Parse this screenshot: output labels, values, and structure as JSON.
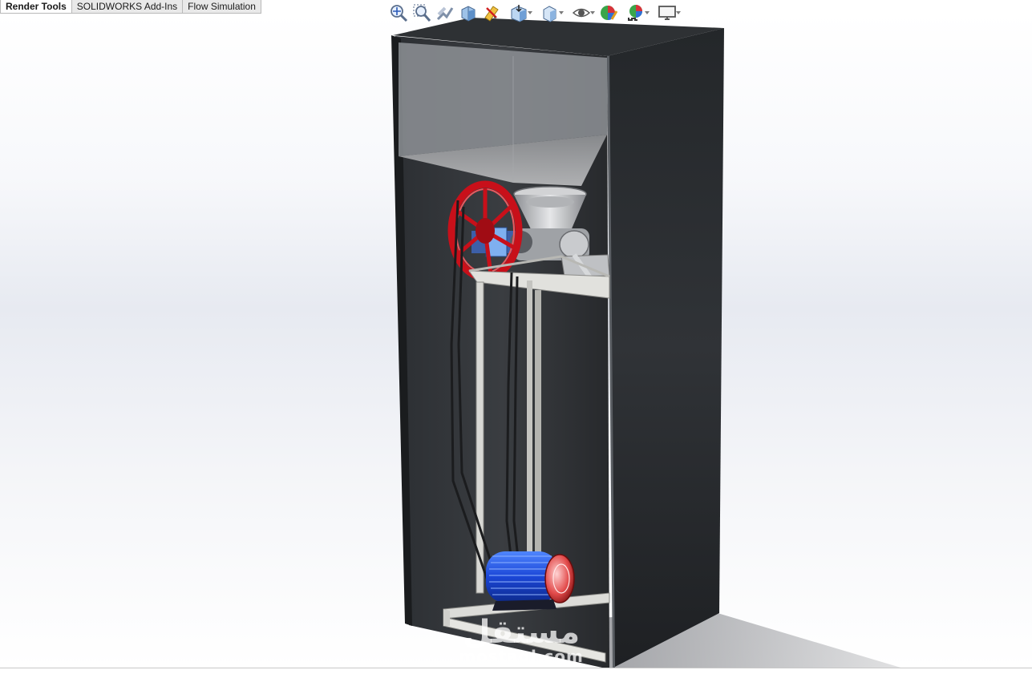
{
  "tabs": [
    {
      "label": "Render Tools",
      "active": true
    },
    {
      "label": "SOLIDWORKS Add-Ins",
      "active": false
    },
    {
      "label": "Flow Simulation",
      "active": false
    }
  ],
  "hud_toolbar": [
    {
      "icon": "zoom-to-fit-icon",
      "dropdown": false
    },
    {
      "icon": "zoom-to-area-icon",
      "dropdown": false
    },
    {
      "icon": "previous-view-icon",
      "dropdown": false
    },
    {
      "icon": "section-view-icon",
      "dropdown": false
    },
    {
      "icon": "dynamic-annotation-views-icon",
      "dropdown": false
    },
    {
      "icon": "view-orientation-icon",
      "dropdown": true
    },
    {
      "icon": "display-style-icon",
      "dropdown": true
    },
    {
      "icon": "hide-show-items-icon",
      "dropdown": true
    },
    {
      "icon": "edit-appearance-icon",
      "dropdown": false
    },
    {
      "icon": "apply-scene-icon",
      "dropdown": true
    },
    {
      "icon": "view-settings-icon",
      "dropdown": true
    }
  ],
  "model": {
    "cabinet_color": "#2a2d30",
    "hopper_color": "#9a9a9a",
    "pulley_color": "#c8101a",
    "motor_color": "#1f4fd8",
    "frame_color": "#d8d8d4"
  },
  "watermark": {
    "mark": "مستقل",
    "text": "mostaql.com"
  }
}
